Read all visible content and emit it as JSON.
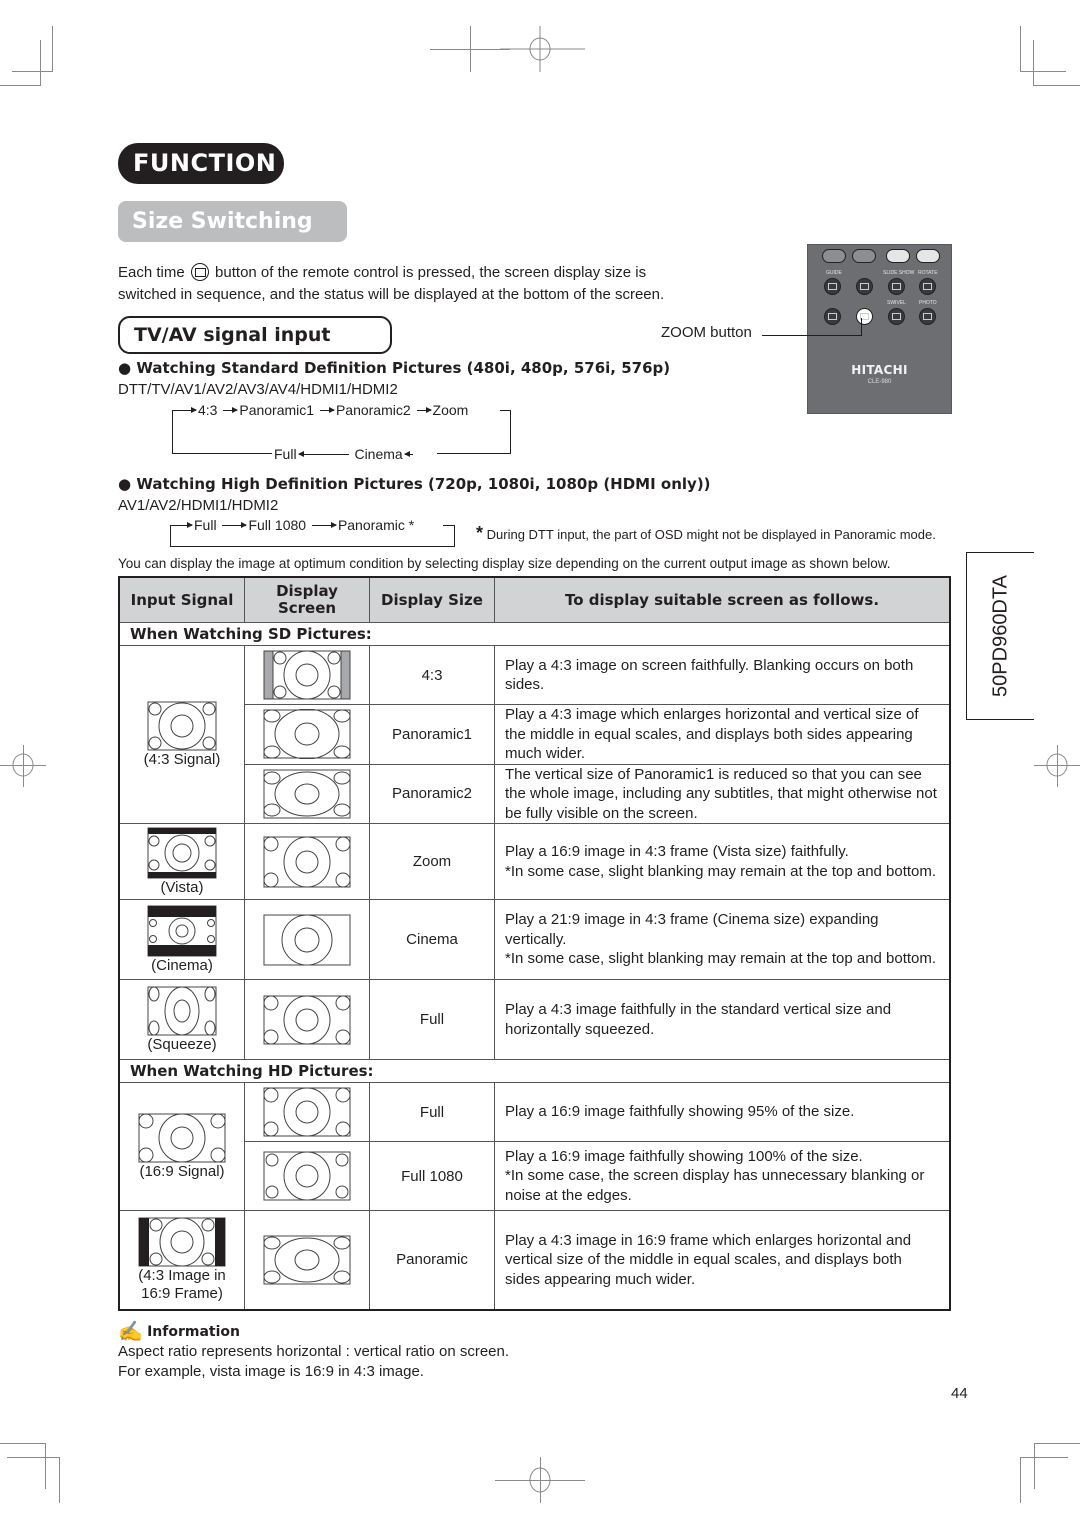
{
  "header": {
    "section": "FUNCTION",
    "title": "Size Switching"
  },
  "intro": {
    "before_icon": "Each time",
    "icon": "zoom-button-icon",
    "after_icon": "button of the remote control is pressed, the screen display size is",
    "line2": "switched in sequence, and the status will be displayed at the bottom of the screen."
  },
  "remote": {
    "callout": "ZOOM button",
    "brand": "HITACHI",
    "model": "CLE-980",
    "labels": [
      "GUIDE",
      "SLIDE SHOW",
      "ROTATE",
      "SWIVEL",
      "PHOTO"
    ]
  },
  "subsection": {
    "title": "TV/AV signal input"
  },
  "sd": {
    "heading": "Watching Standard Definition Pictures (480i, 480p, 576i, 576p)",
    "inputs": "DTT/TV/AV1/AV2/AV3/AV4/HDMI1/HDMI2",
    "cycle_top": [
      "4:3",
      "Panoramic1",
      "Panoramic2",
      "Zoom"
    ],
    "cycle_bottom": [
      "Full",
      "Cinema"
    ]
  },
  "hd": {
    "heading": "Watching High Definition Pictures (720p, 1080i, 1080p (HDMI only))",
    "inputs": "AV1/AV2/HDMI1/HDMI2",
    "cycle": [
      "Full",
      "Full 1080",
      "Panoramic *"
    ],
    "footnote_mark": "*",
    "footnote": "During DTT input, the part of OSD might not be displayed in Panoramic mode."
  },
  "table_intro": "You can display the image at optimum condition by selecting display size depending on the current output image as shown below.",
  "side_tab": "50PD960DTA",
  "table": {
    "headers": [
      "Input Signal",
      "Display Screen",
      "Display Size",
      "To display suitable screen as follows."
    ],
    "sd_section": "When Watching SD Pictures:",
    "hd_section": "When Watching HD Pictures:",
    "sd_rows": [
      {
        "signal": "(4:3 Signal)",
        "size": "4:3",
        "desc": "Play a 4:3 image on screen faithfully. Blanking occurs on both sides."
      },
      {
        "signal": "",
        "size": "Panoramic1",
        "desc": "Play a 4:3 image which enlarges horizontal and vertical size of the middle in equal scales, and displays both sides appearing much wider."
      },
      {
        "signal": "",
        "size": "Panoramic2",
        "desc": "The vertical size of Panoramic1 is reduced so that you can see the whole image, including any subtitles, that might otherwise not be fully visible on the screen."
      },
      {
        "signal": "(Vista)",
        "size": "Zoom",
        "desc": "Play a 16:9 image in 4:3 frame (Vista size) faithfully.\n*In some case, slight blanking may remain at the top and bottom."
      },
      {
        "signal": "(Cinema)",
        "size": "Cinema",
        "desc": "Play a 21:9 image in 4:3 frame (Cinema size) expanding vertically.\n*In some case, slight blanking may remain at the top and bottom."
      },
      {
        "signal": "(Squeeze)",
        "size": "Full",
        "desc": "Play a 4:3 image faithfully in the standard vertical size and horizontally squeezed."
      }
    ],
    "hd_rows": [
      {
        "signal": "(16:9 Signal)",
        "size": "Full",
        "desc": "Play a 16:9 image faithfully showing 95% of the size."
      },
      {
        "signal": "",
        "size": "Full 1080",
        "desc": "Play a 16:9 image faithfully showing 100% of the size.\n*In some case, the screen display has unnecessary blanking or noise at the edges."
      },
      {
        "signal": "(4:3 Image in\n16:9 Frame)",
        "size": "Panoramic",
        "desc": "Play a 4:3 image in 16:9 frame which enlarges horizontal and vertical size of the middle in equal scales, and displays both sides appearing much wider."
      }
    ]
  },
  "information": {
    "icon": "writing-hand-icon",
    "title": "Information",
    "lines": [
      "Aspect ratio represents horizontal : vertical ratio on screen.",
      "For example, vista image is 16:9 in 4:3 image."
    ]
  },
  "page_number": "44"
}
